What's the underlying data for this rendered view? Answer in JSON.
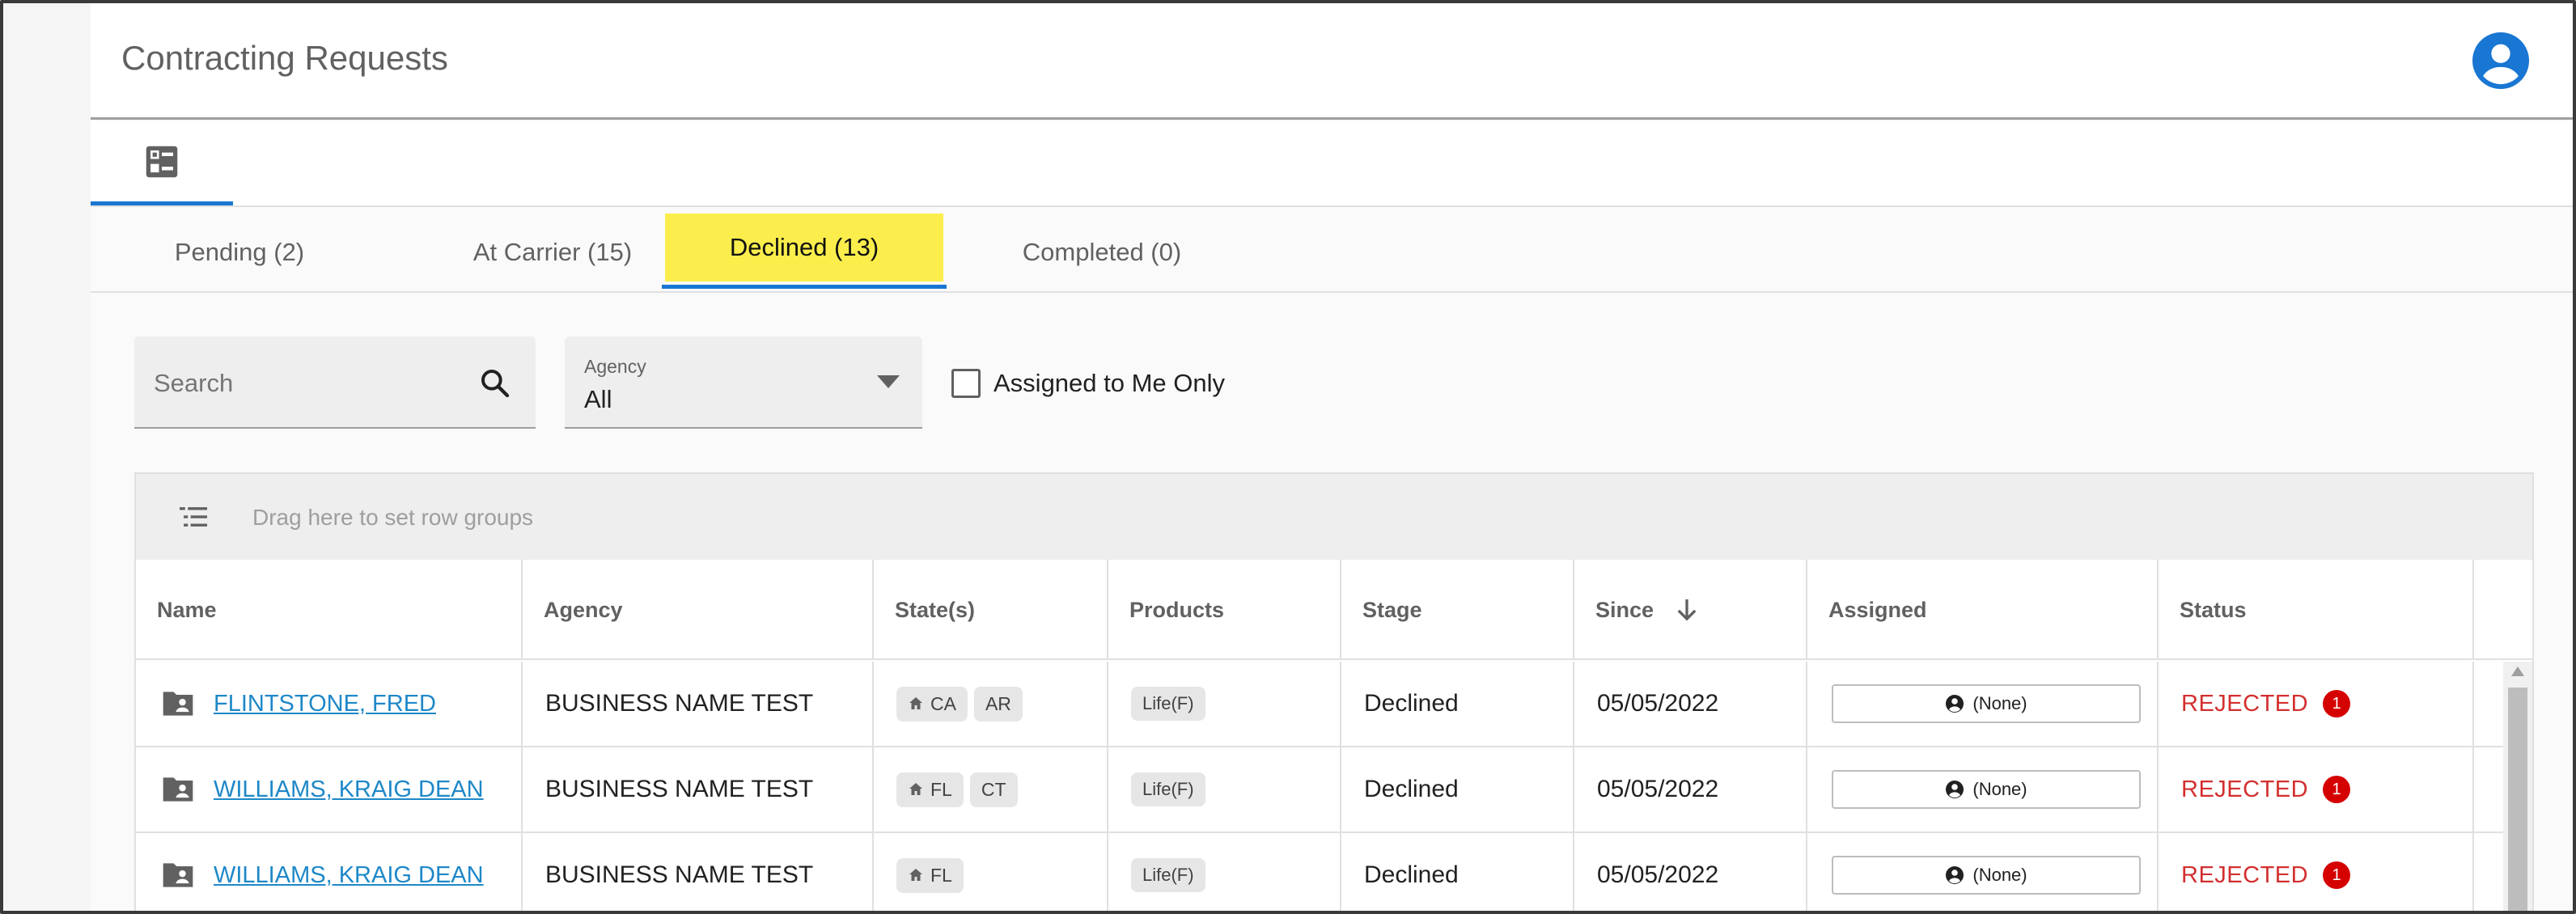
{
  "header": {
    "title": "Contracting Requests",
    "avatar_icon": "account-circle-icon"
  },
  "icon_tabs": [
    {
      "icon": "list-view-icon",
      "active": true
    }
  ],
  "tabs": [
    {
      "label": "Pending (2)",
      "active": false
    },
    {
      "label": "At Carrier (15)",
      "active": false
    },
    {
      "label": "Declined (13)",
      "active": true
    },
    {
      "label": "Completed (0)",
      "active": false
    }
  ],
  "filters": {
    "search_placeholder": "Search",
    "agency_label": "Agency",
    "agency_value": "All",
    "assigned_only_label": "Assigned to Me Only",
    "assigned_only_checked": false
  },
  "grid": {
    "group_panel_text": "Drag here to set row groups",
    "columns": [
      "Name",
      "Agency",
      "State(s)",
      "Products",
      "Stage",
      "Since",
      "Assigned",
      "Status"
    ],
    "sort_column": "Since",
    "sort_direction": "descending",
    "rows": [
      {
        "name": "FLINTSTONE, FRED",
        "agency": "BUSINESS NAME TEST",
        "home_state": "CA",
        "other_states": [
          "AR"
        ],
        "product": "Life(F)",
        "stage": "Declined",
        "since": "05/05/2022",
        "assigned": "(None)",
        "status": "REJECTED",
        "badge": "1"
      },
      {
        "name": "WILLIAMS, KRAIG DEAN",
        "agency": "BUSINESS NAME TEST",
        "home_state": "FL",
        "other_states": [
          "CT"
        ],
        "product": "Life(F)",
        "stage": "Declined",
        "since": "05/05/2022",
        "assigned": "(None)",
        "status": "REJECTED",
        "badge": "1"
      },
      {
        "name": "WILLIAMS, KRAIG DEAN",
        "agency": "BUSINESS NAME TEST",
        "home_state": "FL",
        "other_states": [],
        "product": "Life(F)",
        "stage": "Declined",
        "since": "05/05/2022",
        "assigned": "(None)",
        "status": "REJECTED",
        "badge": "1"
      }
    ]
  },
  "colors": {
    "accent": "#1976d2",
    "active_tab_bg": "#fbee4c",
    "link": "#1e88c8",
    "status_rejected": "#d32f2f",
    "badge": "#d50000"
  }
}
